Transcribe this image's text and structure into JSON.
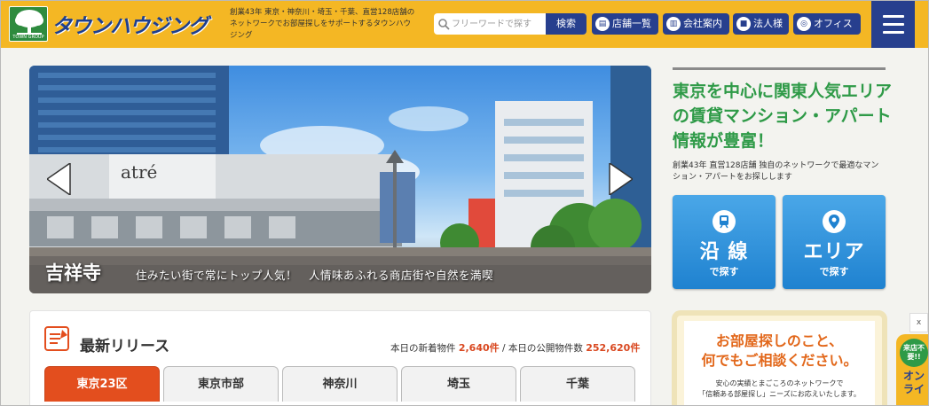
{
  "header": {
    "logo_text": "タウンハウジング",
    "logo_sub": "TOWN GROUP",
    "tagline": "創業43年 東京・神奈川・埼玉・千葉、直営128店舗のネットワークでお部屋探しをサポートするタウンハウジング",
    "search_placeholder": "フリーワードで探す",
    "search_button": "検索",
    "nav": [
      {
        "label": "店舗一覧",
        "icon": "shop-icon"
      },
      {
        "label": "会社案内",
        "icon": "building-icon"
      },
      {
        "label": "法人様",
        "icon": "briefcase-icon"
      },
      {
        "label": "オフィス",
        "icon": "search-office-icon"
      }
    ],
    "menu_icon": "hamburger-menu-icon",
    "colors": {
      "bar": "#f4b724",
      "navy": "#273f8e"
    }
  },
  "hero": {
    "place": "吉祥寺",
    "description": "住みたい街で常にトップ人気！　人情味あふれる商店街や自然を満喫",
    "building_sign": "atré"
  },
  "right": {
    "headline": "東京を中心に関東人気エリアの賃貸マンション・アパート情報が豊富！",
    "sub": "創業43年 直営128店舗 独自のネットワークで最適なマンション・アパートをお探しします",
    "buttons": [
      {
        "title": "沿 線",
        "sub": "で探す",
        "icon": "train-icon"
      },
      {
        "title": "エリア",
        "sub": "で探す",
        "icon": "map-pin-icon"
      }
    ]
  },
  "release": {
    "title": "最新リリース",
    "stats_label_1": "本日の新着物件",
    "stats_value_1": "2,640件",
    "stats_sep": " / ",
    "stats_label_2": "本日の公開物件数",
    "stats_value_2": "252,620件",
    "tabs": [
      "東京23区",
      "東京市部",
      "神奈川",
      "埼玉",
      "千葉"
    ],
    "active_tab": 0,
    "accent": "#e34e1e"
  },
  "consult": {
    "line1": "お部屋探しのこと、",
    "line2": "何でもご相談ください。",
    "sub1": "安心の実績とまごころのネットワークで",
    "sub2": "「信頼ある部屋探し」ニーズにお応えいたします。"
  },
  "side": {
    "close": "x",
    "circle": "来店不要!!",
    "text": "オンライ"
  }
}
